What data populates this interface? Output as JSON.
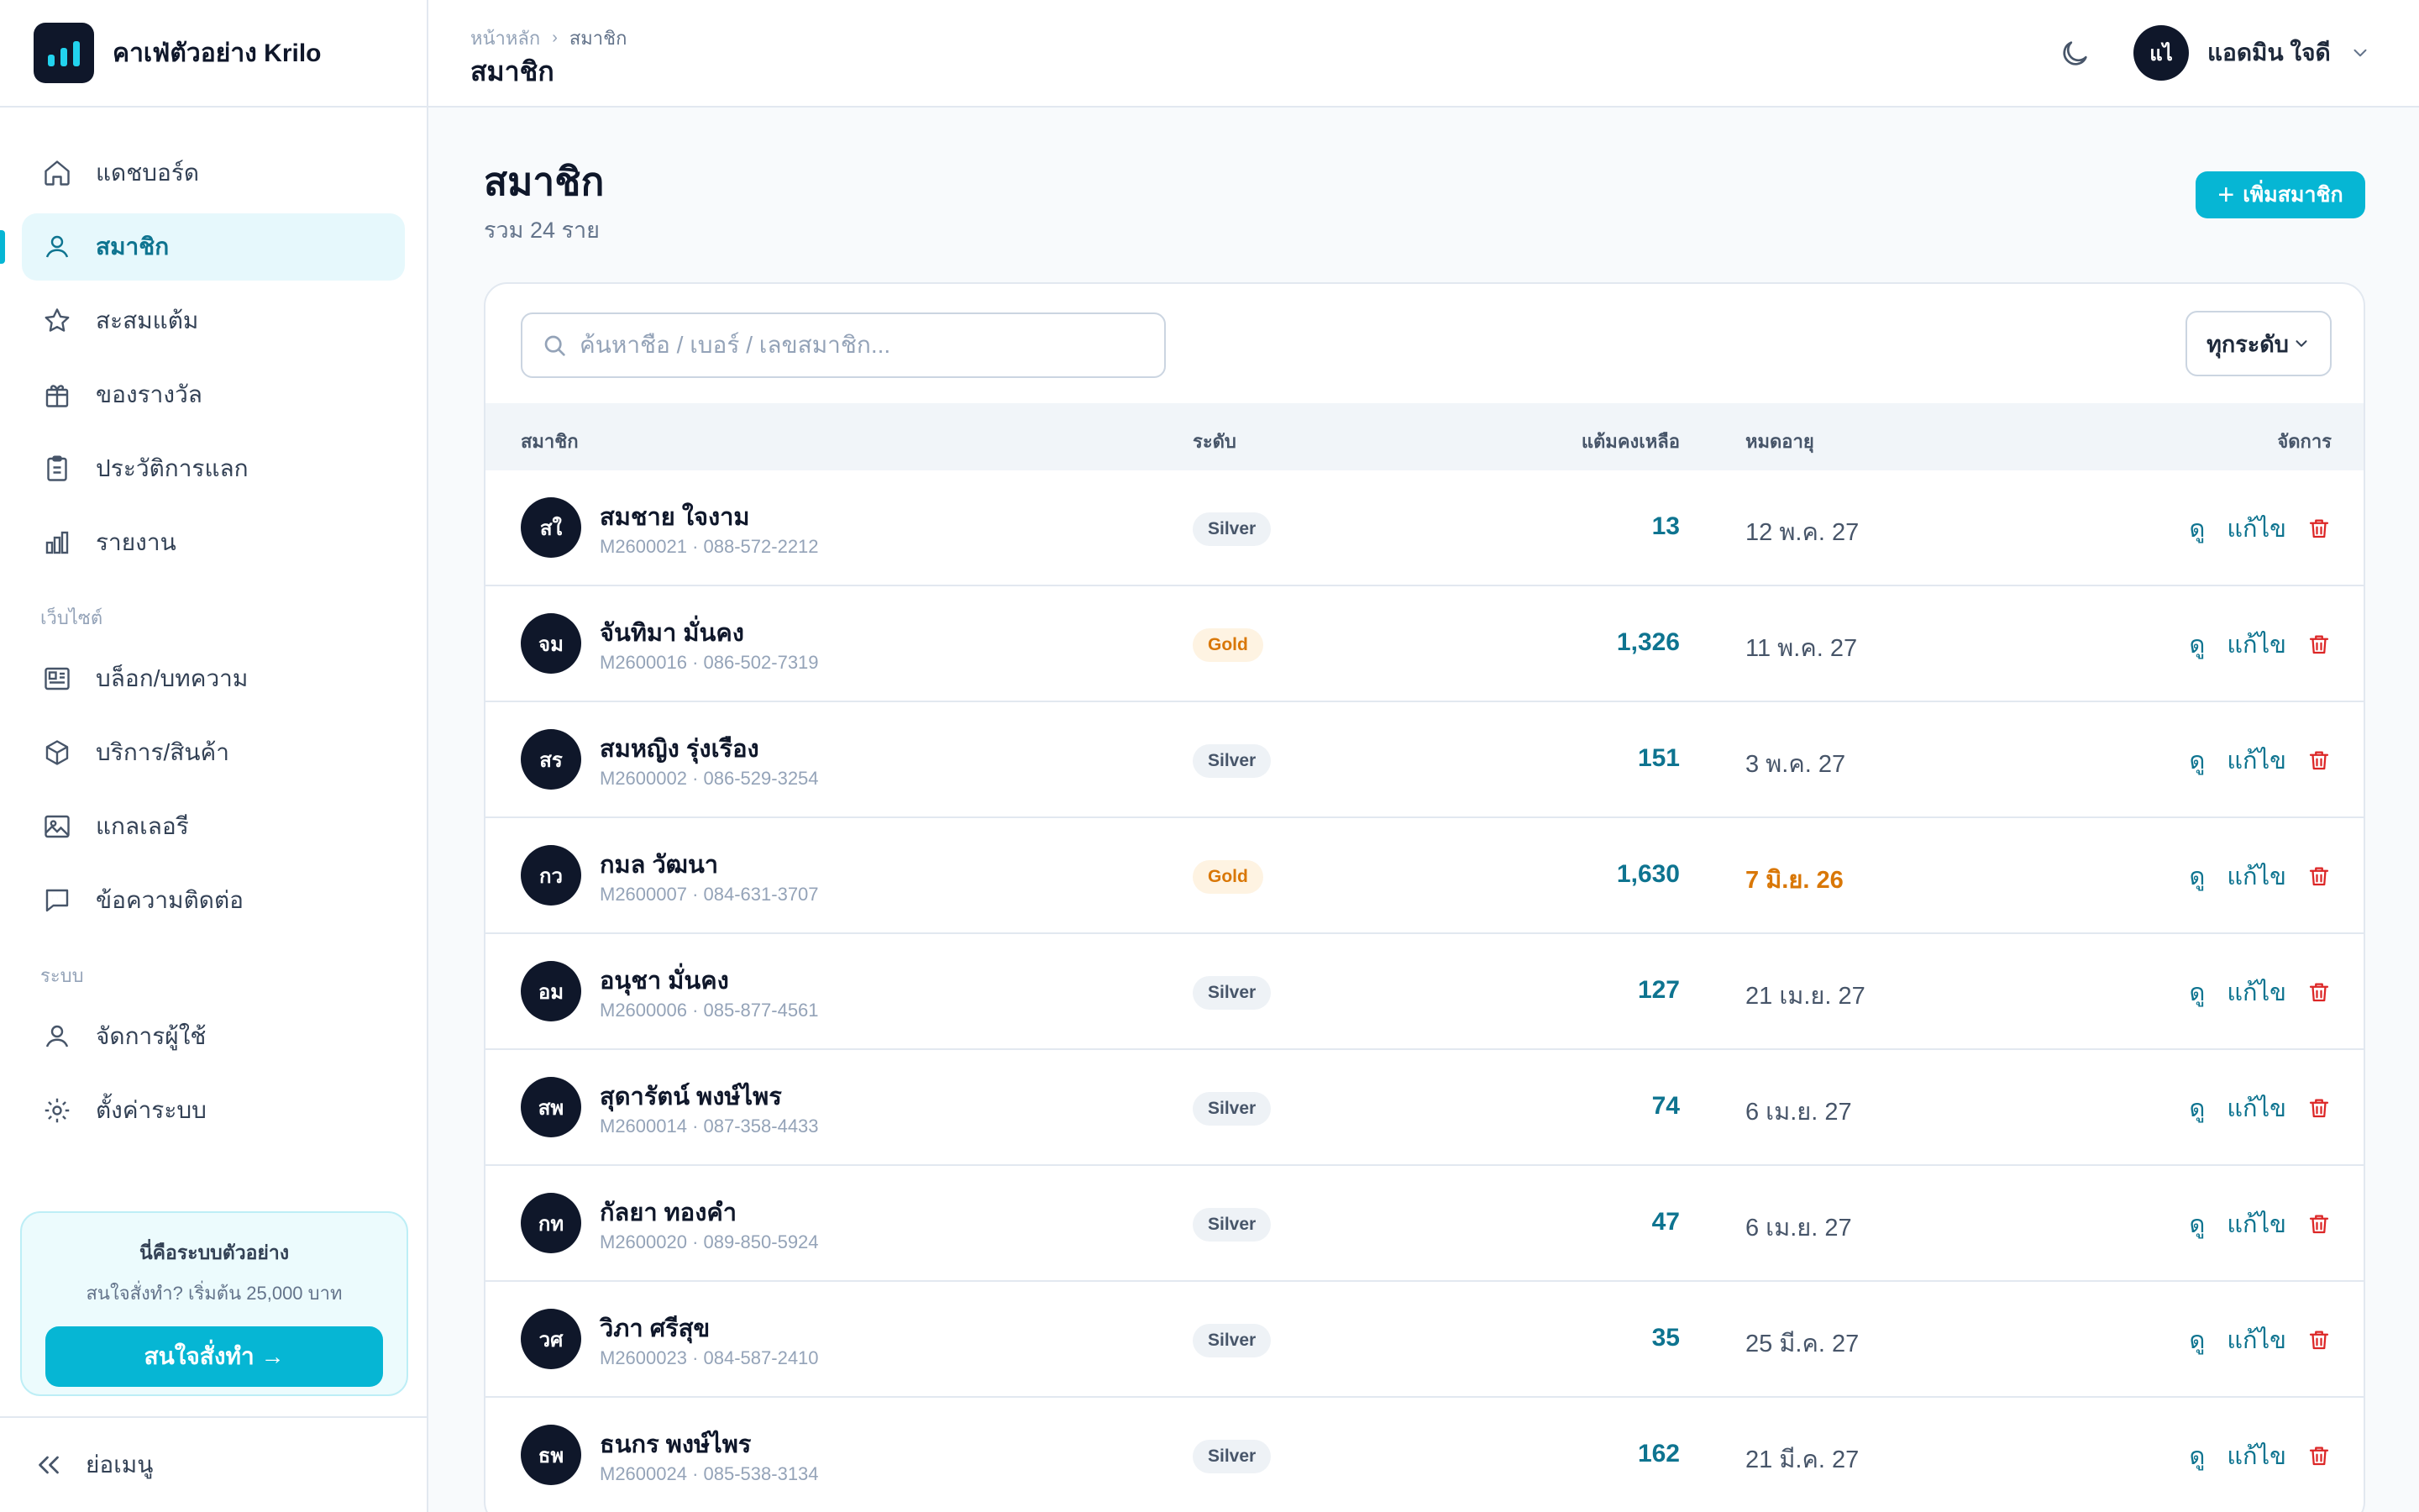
{
  "brand": {
    "name": "คาเฟ่ตัวอย่าง Krilo"
  },
  "nav": {
    "main": [
      {
        "label": "แดชบอร์ด",
        "icon": "home-icon"
      },
      {
        "label": "สมาชิก",
        "icon": "user-icon",
        "active": true
      },
      {
        "label": "สะสมแต้ม",
        "icon": "star-icon"
      },
      {
        "label": "ของรางวัล",
        "icon": "gift-icon"
      },
      {
        "label": "ประวัติการแลก",
        "icon": "clipboard-icon"
      },
      {
        "label": "รายงาน",
        "icon": "bar-chart-icon"
      }
    ],
    "website_section": "เว็บไซต์",
    "website": [
      {
        "label": "บล็อก/บทความ",
        "icon": "newspaper-icon"
      },
      {
        "label": "บริการ/สินค้า",
        "icon": "box-icon"
      },
      {
        "label": "แกลเลอรี",
        "icon": "image-icon"
      },
      {
        "label": "ข้อความติดต่อ",
        "icon": "message-icon"
      }
    ],
    "system_section": "ระบบ",
    "system": [
      {
        "label": "จัดการผู้ใช้",
        "icon": "user-icon"
      },
      {
        "label": "ตั้งค่าระบบ",
        "icon": "gear-icon"
      }
    ]
  },
  "promo": {
    "title": "นี่คือระบบตัวอย่าง",
    "subtitle": "สนใจสั่งทำ? เริ่มต้น 25,000 บาท",
    "button": "สนใจสั่งทำ →"
  },
  "collapse_label": "ย่อเมนู",
  "header": {
    "breadcrumb_home": "หน้าหลัก",
    "breadcrumb_current": "สมาชิก",
    "title": "สมาชิก",
    "user_initials": "แไ",
    "user_name": "แอดมิน ใจดี"
  },
  "page": {
    "title": "สมาชิก",
    "subtitle": "รวม 24 ราย",
    "add_button": "เพิ่มสมาชิก"
  },
  "search": {
    "placeholder": "ค้นหาชื่อ / เบอร์ / เลขสมาชิก..."
  },
  "filter": {
    "selected": "ทุกระดับ"
  },
  "table": {
    "columns": {
      "member": "สมาชิก",
      "tier": "ระดับ",
      "points": "แต้มคงเหลือ",
      "expiry": "หมดอายุ",
      "actions": "จัดการ"
    },
    "view_label": "ดู",
    "edit_label": "แก้ไข",
    "rows": [
      {
        "initials": "สใ",
        "name": "สมชาย ใจงาม",
        "meta": "M2600021 · 088-572-2212",
        "tier": "Silver",
        "points": "13",
        "expiry": "12 พ.ค. 27"
      },
      {
        "initials": "จม",
        "name": "จันทิมา มั่นคง",
        "meta": "M2600016 · 086-502-7319",
        "tier": "Gold",
        "points": "1,326",
        "expiry": "11 พ.ค. 27"
      },
      {
        "initials": "สร",
        "name": "สมหญิง รุ่งเรือง",
        "meta": "M2600002 · 086-529-3254",
        "tier": "Silver",
        "points": "151",
        "expiry": "3 พ.ค. 27"
      },
      {
        "initials": "กว",
        "name": "กมล วัฒนา",
        "meta": "M2600007 · 084-631-3707",
        "tier": "Gold",
        "points": "1,630",
        "expiry": "7 มิ.ย. 26",
        "expiry_warn": true
      },
      {
        "initials": "อม",
        "name": "อนุชา มั่นคง",
        "meta": "M2600006 · 085-877-4561",
        "tier": "Silver",
        "points": "127",
        "expiry": "21 เม.ย. 27"
      },
      {
        "initials": "สพ",
        "name": "สุดารัตน์ พงษ์ไพร",
        "meta": "M2600014 · 087-358-4433",
        "tier": "Silver",
        "points": "74",
        "expiry": "6 เม.ย. 27"
      },
      {
        "initials": "กท",
        "name": "กัลยา ทองคำ",
        "meta": "M2600020 · 089-850-5924",
        "tier": "Silver",
        "points": "47",
        "expiry": "6 เม.ย. 27"
      },
      {
        "initials": "วศ",
        "name": "วิภา ศรีสุข",
        "meta": "M2600023 · 084-587-2410",
        "tier": "Silver",
        "points": "35",
        "expiry": "25 มี.ค. 27"
      },
      {
        "initials": "ธพ",
        "name": "ธนกร พงษ์ไพร",
        "meta": "M2600024 · 085-538-3134",
        "tier": "Silver",
        "points": "162",
        "expiry": "21 มี.ค. 27"
      }
    ]
  },
  "colors": {
    "accent": "#06b6d4",
    "accent_dark": "#0e7490",
    "navy": "#0f172a",
    "gold": "#d97706",
    "danger": "#dc2626"
  }
}
